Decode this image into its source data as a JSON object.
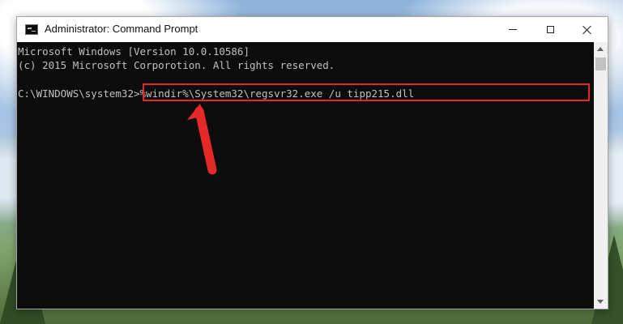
{
  "window": {
    "title": "Administrator: Command Prompt",
    "icon": "command-prompt-icon",
    "controls": [
      "minimize-icon",
      "maximize-icon",
      "close-icon"
    ]
  },
  "console": {
    "lines": [
      "Microsoft Windows [Version 10.0.10586]",
      "(c) 2015 Microsoft Corporotion. All rights reserved."
    ],
    "prompt": "C:\\WINDOWS\\system32>",
    "command": "%windir%\\System32\\regsvr32.exe /u tipp215.dll"
  },
  "annotation": {
    "highlight_color": "#e52828",
    "arrow_color": "#e52828"
  }
}
